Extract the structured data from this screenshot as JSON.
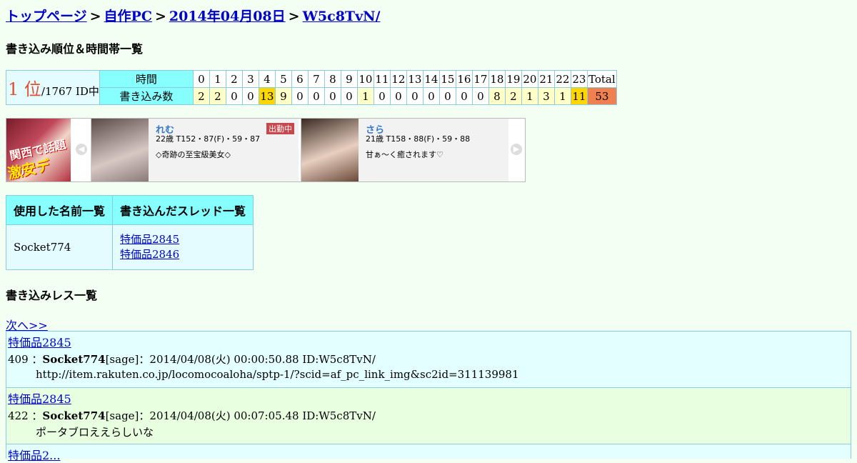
{
  "breadcrumb": {
    "items": [
      "トップページ",
      "自作PC",
      "2014年04月08日",
      "W5c8TvN/"
    ],
    "separator": ">"
  },
  "rank_section": {
    "title": "書き込み順位＆時間帯一覧",
    "rank_num": "1 位",
    "rank_of": "/1767 ID中",
    "time_label": "時間",
    "count_label": "書き込み数",
    "hours": [
      "0",
      "1",
      "2",
      "3",
      "4",
      "5",
      "6",
      "7",
      "8",
      "9",
      "10",
      "11",
      "12",
      "13",
      "14",
      "15",
      "16",
      "17",
      "18",
      "19",
      "20",
      "21",
      "22",
      "23"
    ],
    "total_label": "Total",
    "counts": [
      "2",
      "2",
      "0",
      "0",
      "13",
      "9",
      "0",
      "0",
      "0",
      "0",
      "1",
      "0",
      "0",
      "0",
      "0",
      "0",
      "0",
      "0",
      "8",
      "2",
      "1",
      "3",
      "1",
      "11"
    ],
    "total": "53",
    "colors": {
      "zero": "#ffffff",
      "low": "#ffffc8",
      "high": "#ffd700",
      "total": "#f08050"
    }
  },
  "ad": {
    "banner_text_1": "関西で話題の",
    "banner_text_2": "激安デリ!!",
    "prev_icon": "chevron-left-icon",
    "next_icon": "chevron-right-icon",
    "cards": [
      {
        "name": "れむ",
        "stats": "22歳 T152・87(F)・59・87",
        "desc": "◇奇跡の至宝級美女◇",
        "badge": "出勤中"
      },
      {
        "name": "さら",
        "stats": "21歳 T158・88(F)・59・88",
        "desc": "甘ぁ～く癒されます♡",
        "badge": ""
      }
    ]
  },
  "names_table": {
    "col_names": "使用した名前一覧",
    "col_threads": "書き込んだスレッド一覧",
    "name": "Socket774",
    "threads": [
      "特価品2845",
      "特価品2846"
    ]
  },
  "res_section": {
    "title": "書き込みレス一覧",
    "next_link": "次へ>>"
  },
  "posts": [
    {
      "thread": "特価品2845",
      "num": "409",
      "name": "Socket774",
      "meta": "[sage]：2014/04/08(火) 00:00:50.88 ID:W5c8TvN/",
      "body": "http://item.rakuten.co.jp/locomocoaloha/sptp-1/?scid=af_pc_link_img&sc2id=311139981"
    },
    {
      "thread": "特価品2845",
      "num": "422",
      "name": "Socket774",
      "meta": "[sage]：2014/04/08(火) 00:07:05.48 ID:W5c8TvN/",
      "body": "ポータブロええらしいな"
    },
    {
      "thread": "特価品2..."
    }
  ]
}
